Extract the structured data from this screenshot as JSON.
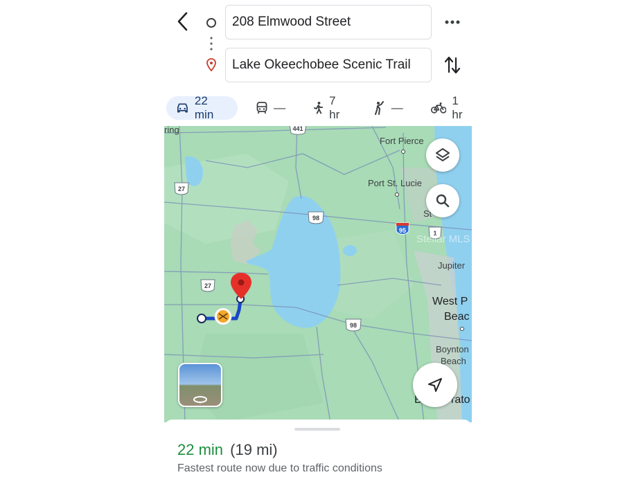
{
  "header": {
    "origin": "208 Elmwood Street",
    "destination": "Lake Okeechobee Scenic Trail"
  },
  "modes": [
    {
      "icon": "car-icon",
      "label": "22 min",
      "active": true
    },
    {
      "icon": "transit-icon",
      "label": "—"
    },
    {
      "icon": "walk-icon",
      "label": "7 hr"
    },
    {
      "icon": "rideshare-icon",
      "label": "—"
    },
    {
      "icon": "bike-icon",
      "label": "1 hr"
    }
  ],
  "map": {
    "places": {
      "ring": "ring",
      "fort_pierce": "Fort Pierce",
      "port_st_lucie": "Port St. Lucie",
      "st": "St",
      "jupiter": "Jupiter",
      "west_p": "West P",
      "beac": "Beac",
      "boynton": "Boynton",
      "beach": "Beach",
      "b": "B",
      "rato": "rato",
      "watermark": "Stellar MLS"
    },
    "shields": {
      "us441": "441",
      "us27_top": "27",
      "us98_top": "98",
      "i95": "95",
      "us1": "1",
      "us27_mid": "27",
      "us98_bottom": "98"
    },
    "route_color": "#1a47c5",
    "pin_color": "#e5302a",
    "water_color": "#8fd0ef",
    "land_color": "#a7dcb8"
  },
  "sheet": {
    "time": "22 min",
    "distance": "(19 mi)",
    "note": "Fastest route now due to traffic conditions"
  }
}
